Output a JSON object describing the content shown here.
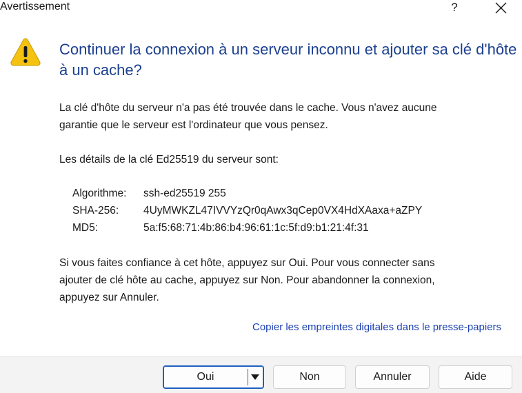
{
  "window": {
    "title": "Avertissement",
    "help_label": "?"
  },
  "dialog": {
    "icon": "warning-icon",
    "heading": "Continuer la connexion à un serveur inconnu et ajouter sa clé d'hôte à un cache?",
    "paragraph1_line1": "La clé d'hôte du serveur n'a pas été trouvée dans le cache. Vous n'avez aucune",
    "paragraph1_line2": "garantie que le serveur est l'ordinateur que vous pensez.",
    "paragraph2": "Les détails de la clé Ed25519 du serveur sont:",
    "fingerprints": [
      {
        "label": "Algorithme:",
        "value": "ssh-ed25519 255"
      },
      {
        "label": "SHA-256:",
        "value": "4UyMWKZL47IVVYzQr0qAwx3qCep0VX4HdXAaxa+aZPY"
      },
      {
        "label": "MD5:",
        "value": "5a:f5:68:71:4b:86:b4:96:61:1c:5f:d9:b1:21:4f:31"
      }
    ],
    "paragraph3_line1": "Si vous faites confiance à cet hôte, appuyez sur Oui. Pour vous connecter sans",
    "paragraph3_line2": "ajouter de clé hôte au cache, appuyez sur Non. Pour abandonner la connexion,",
    "paragraph3_line3": "appuyez sur Annuler.",
    "copy_link": "Copier les empreintes digitales dans le presse-papiers"
  },
  "buttons": {
    "yes": "Oui",
    "no": "Non",
    "cancel": "Annuler",
    "help": "Aide"
  },
  "colors": {
    "heading": "#1b3f8f",
    "link": "#1a3fb0",
    "default_button_border": "#1f5fbf",
    "warning_fill": "#f5c211"
  }
}
